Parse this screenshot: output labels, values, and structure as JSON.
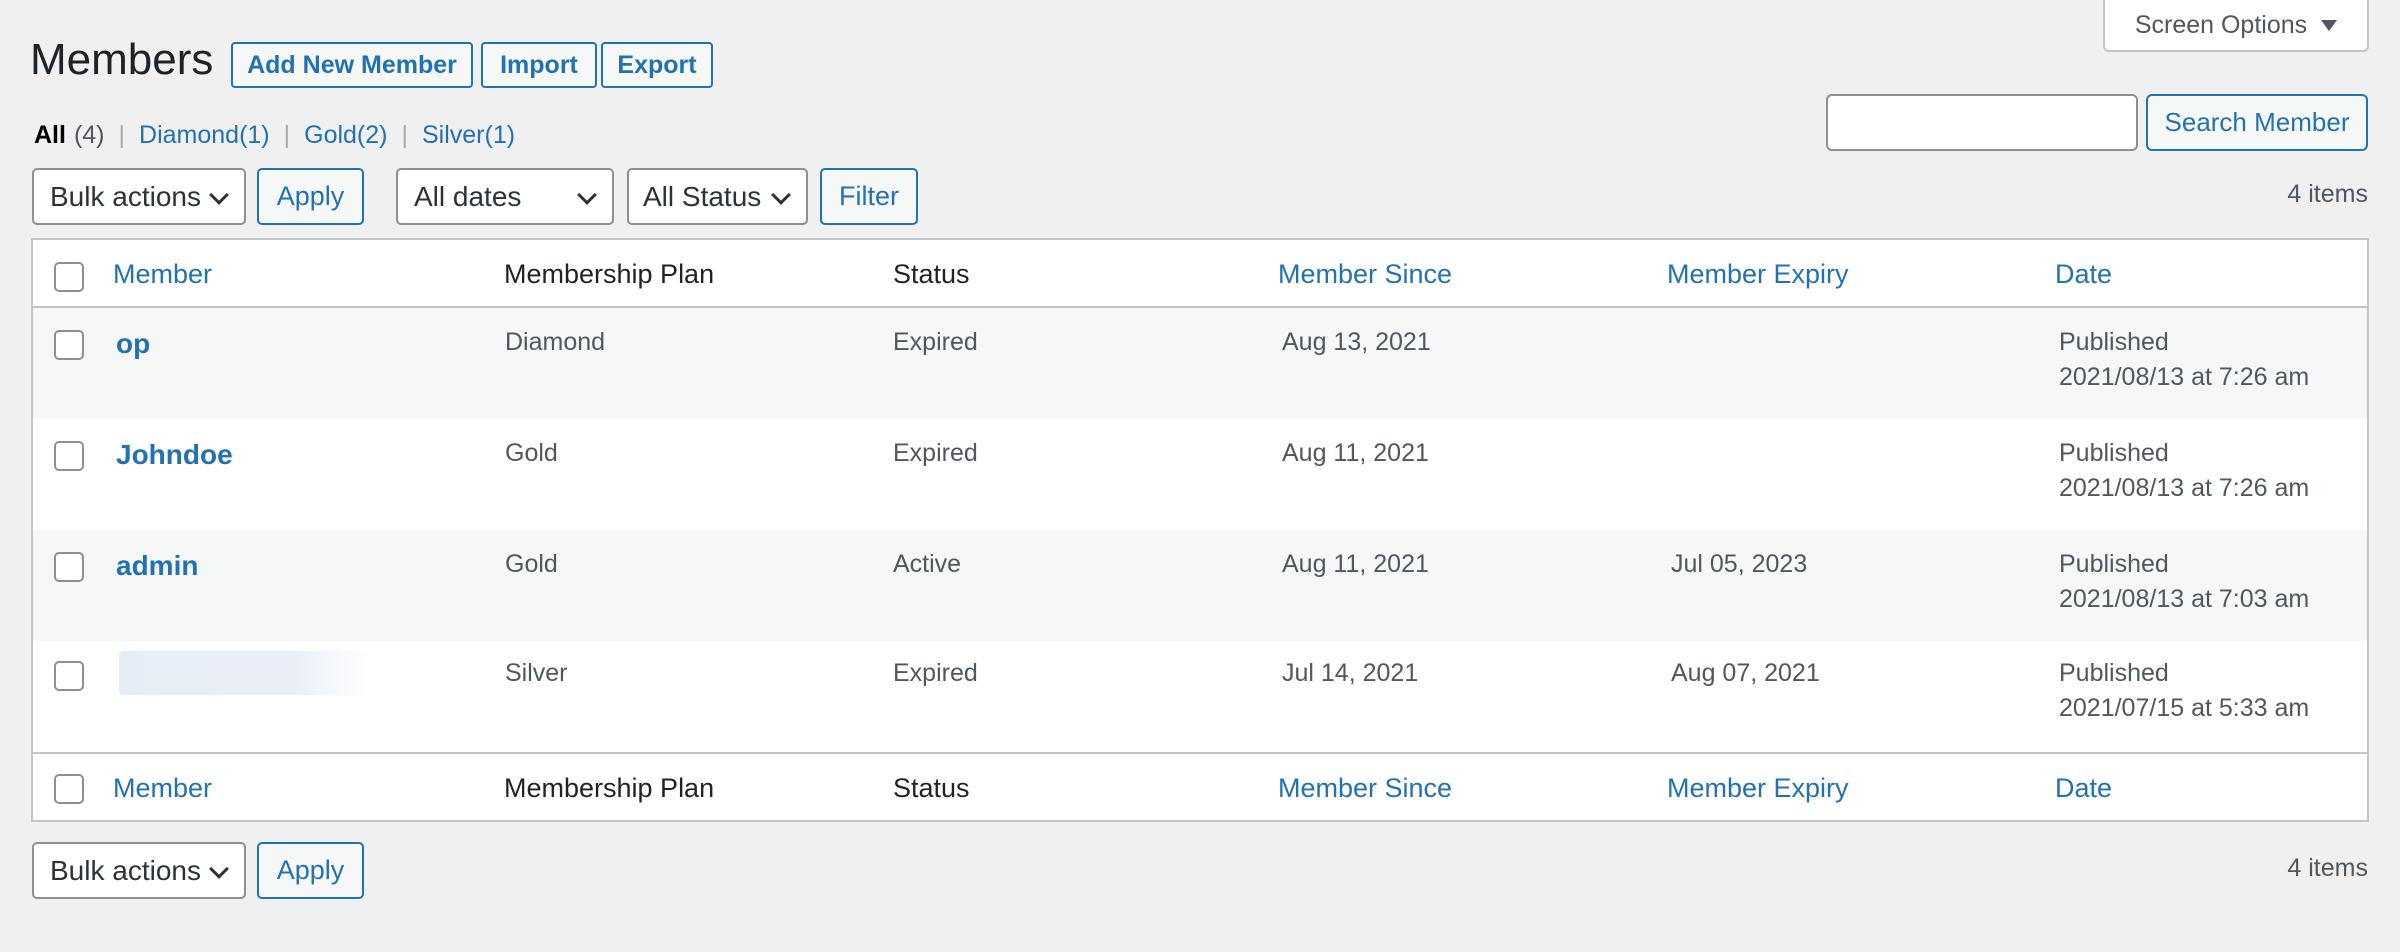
{
  "header": {
    "title": "Members",
    "buttons": {
      "add_new": "Add New Member",
      "import": "Import",
      "export": "Export"
    },
    "screen_options": "Screen Options"
  },
  "views": {
    "all": {
      "label": "All",
      "count": "(4)"
    },
    "items": [
      {
        "label": "Diamond(1)"
      },
      {
        "label": "Gold(2)"
      },
      {
        "label": "Silver(1)"
      }
    ],
    "separator": "|"
  },
  "search": {
    "value": "",
    "placeholder": "",
    "button": "Search Member"
  },
  "tablenav_top": {
    "bulk_actions": "Bulk actions",
    "apply": "Apply",
    "dates": "All dates",
    "status": "All Status",
    "filter": "Filter",
    "count": "4 items"
  },
  "table": {
    "columns": {
      "member": "Member",
      "plan": "Membership Plan",
      "status": "Status",
      "since": "Member Since",
      "expiry": "Member Expiry",
      "date": "Date"
    },
    "rows": [
      {
        "member": "op",
        "plan": "Diamond",
        "status": "Expired",
        "since": "Aug 13, 2021",
        "expiry": "",
        "date_status": "Published",
        "date_value": "2021/08/13 at 7:26 am"
      },
      {
        "member": "Johndoe",
        "plan": "Gold",
        "status": "Expired",
        "since": "Aug 11, 2021",
        "expiry": "",
        "date_status": "Published",
        "date_value": "2021/08/13 at 7:26 am"
      },
      {
        "member": "admin",
        "plan": "Gold",
        "status": "Active",
        "since": "Aug 11, 2021",
        "expiry": "Jul 05, 2023",
        "date_status": "Published",
        "date_value": "2021/08/13 at 7:03 am"
      },
      {
        "member": "",
        "plan": "Silver",
        "status": "Expired",
        "since": "Jul 14, 2021",
        "expiry": "Aug 07, 2021",
        "date_status": "Published",
        "date_value": "2021/07/15 at 5:33 am"
      }
    ]
  },
  "tablenav_bottom": {
    "bulk_actions": "Bulk actions",
    "apply": "Apply",
    "count": "4 items"
  },
  "colors": {
    "link": "#2271b1",
    "background": "#f0f0f1",
    "border": "#c3c4c7",
    "row_alt": "#f6f7f7"
  }
}
